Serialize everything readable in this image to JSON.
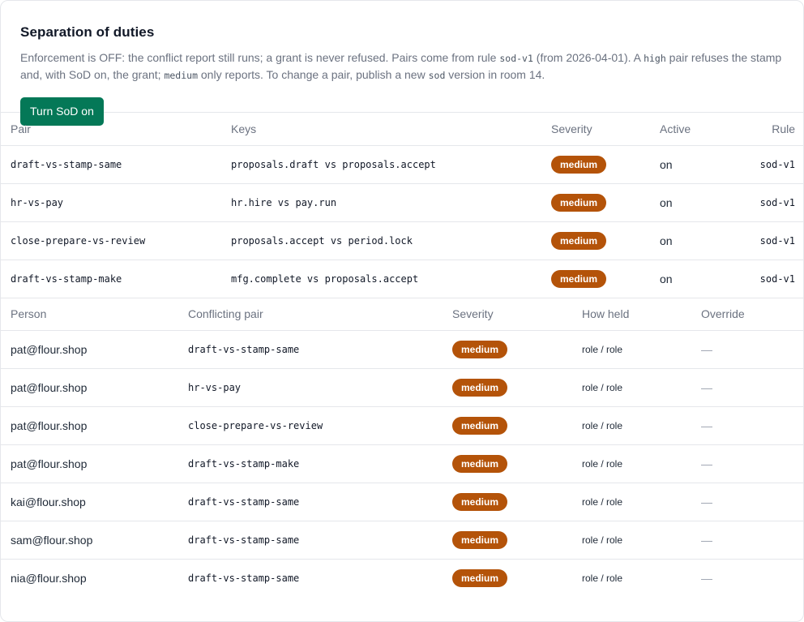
{
  "header": {
    "title": "Separation of duties",
    "desc_1": "Enforcement is OFF: the conflict report still runs; a grant is never refused. Pairs come from rule ",
    "desc_code_1": "sod-v1",
    "desc_2": " (from 2026-04-01). A ",
    "desc_code_2": "high",
    "desc_3": " pair refuses the stamp and, with SoD on, the grant; ",
    "desc_code_3": "medium",
    "desc_4": " only reports. To change a pair, publish a new ",
    "desc_code_4": "sod",
    "desc_5": " version in room 14.",
    "button_label": "Turn SoD on"
  },
  "colors": {
    "accent": "#047857",
    "badge_medium": "#b45309"
  },
  "pairs_table": {
    "columns": {
      "pair": "Pair",
      "keys": "Keys",
      "severity": "Severity",
      "active": "Active",
      "rule": "Rule"
    },
    "rows": [
      {
        "pair": "draft-vs-stamp-same",
        "keys": "proposals.draft vs proposals.accept",
        "severity": "medium",
        "active": "on",
        "rule": "sod-v1"
      },
      {
        "pair": "hr-vs-pay",
        "keys": "hr.hire vs pay.run",
        "severity": "medium",
        "active": "on",
        "rule": "sod-v1"
      },
      {
        "pair": "close-prepare-vs-review",
        "keys": "proposals.accept vs period.lock",
        "severity": "medium",
        "active": "on",
        "rule": "sod-v1"
      },
      {
        "pair": "draft-vs-stamp-make",
        "keys": "mfg.complete vs proposals.accept",
        "severity": "medium",
        "active": "on",
        "rule": "sod-v1"
      }
    ]
  },
  "conflicts_table": {
    "columns": {
      "person": "Person",
      "pair": "Conflicting pair",
      "severity": "Severity",
      "held": "How held",
      "override": "Override"
    },
    "rows": [
      {
        "person": "pat@flour.shop",
        "pair": "draft-vs-stamp-same",
        "severity": "medium",
        "held": "role / role",
        "override": "—"
      },
      {
        "person": "pat@flour.shop",
        "pair": "hr-vs-pay",
        "severity": "medium",
        "held": "role / role",
        "override": "—"
      },
      {
        "person": "pat@flour.shop",
        "pair": "close-prepare-vs-review",
        "severity": "medium",
        "held": "role / role",
        "override": "—"
      },
      {
        "person": "pat@flour.shop",
        "pair": "draft-vs-stamp-make",
        "severity": "medium",
        "held": "role / role",
        "override": "—"
      },
      {
        "person": "kai@flour.shop",
        "pair": "draft-vs-stamp-same",
        "severity": "medium",
        "held": "role / role",
        "override": "—"
      },
      {
        "person": "sam@flour.shop",
        "pair": "draft-vs-stamp-same",
        "severity": "medium",
        "held": "role / role",
        "override": "—"
      },
      {
        "person": "nia@flour.shop",
        "pair": "draft-vs-stamp-same",
        "severity": "medium",
        "held": "role / role",
        "override": "—"
      }
    ]
  }
}
